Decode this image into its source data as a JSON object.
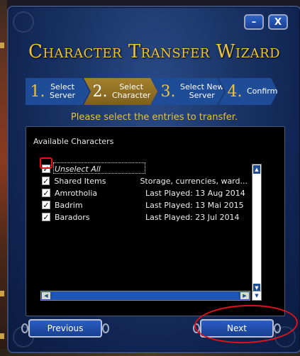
{
  "window": {
    "minimize_label": "–",
    "close_label": "X",
    "title": "Character Transfer Wizard"
  },
  "steps": [
    {
      "number": "1.",
      "label_line1": "Select",
      "label_line2": "Server",
      "active": false
    },
    {
      "number": "2.",
      "label_line1": "Select",
      "label_line2": "Character",
      "active": true
    },
    {
      "number": "3.",
      "label_line1": "Select New",
      "label_line2": "Server",
      "active": false
    },
    {
      "number": "4.",
      "label_line1": "Confirm",
      "label_line2": "",
      "active": false
    }
  ],
  "prompt": "Please select the entries to transfer.",
  "list": {
    "title": "Available Characters",
    "rows": [
      {
        "name": "Unselect All",
        "info": "",
        "checked": true
      },
      {
        "name": "Shared Items",
        "info": "Storage, currencies, ward...",
        "checked": true
      },
      {
        "name": "Amrotholia",
        "info": "Last Played: 13 Aug 2014",
        "checked": true
      },
      {
        "name": "Badrim",
        "info": "Last Played: 13 Mai 2015",
        "checked": true
      },
      {
        "name": "Baradors",
        "info": "Last Played: 23 Jul 2014",
        "checked": true
      }
    ],
    "checkmark": "✓"
  },
  "scroll_icons": {
    "up": "▲",
    "down": "▼",
    "left": "◀",
    "right": "▶"
  },
  "buttons": {
    "previous": "Previous",
    "next": "Next"
  },
  "colors": {
    "title_gold": "#f0c23a",
    "step_active": "#a4812c",
    "step_inactive": "#1e4c97",
    "annotation_red": "#e0121a"
  }
}
